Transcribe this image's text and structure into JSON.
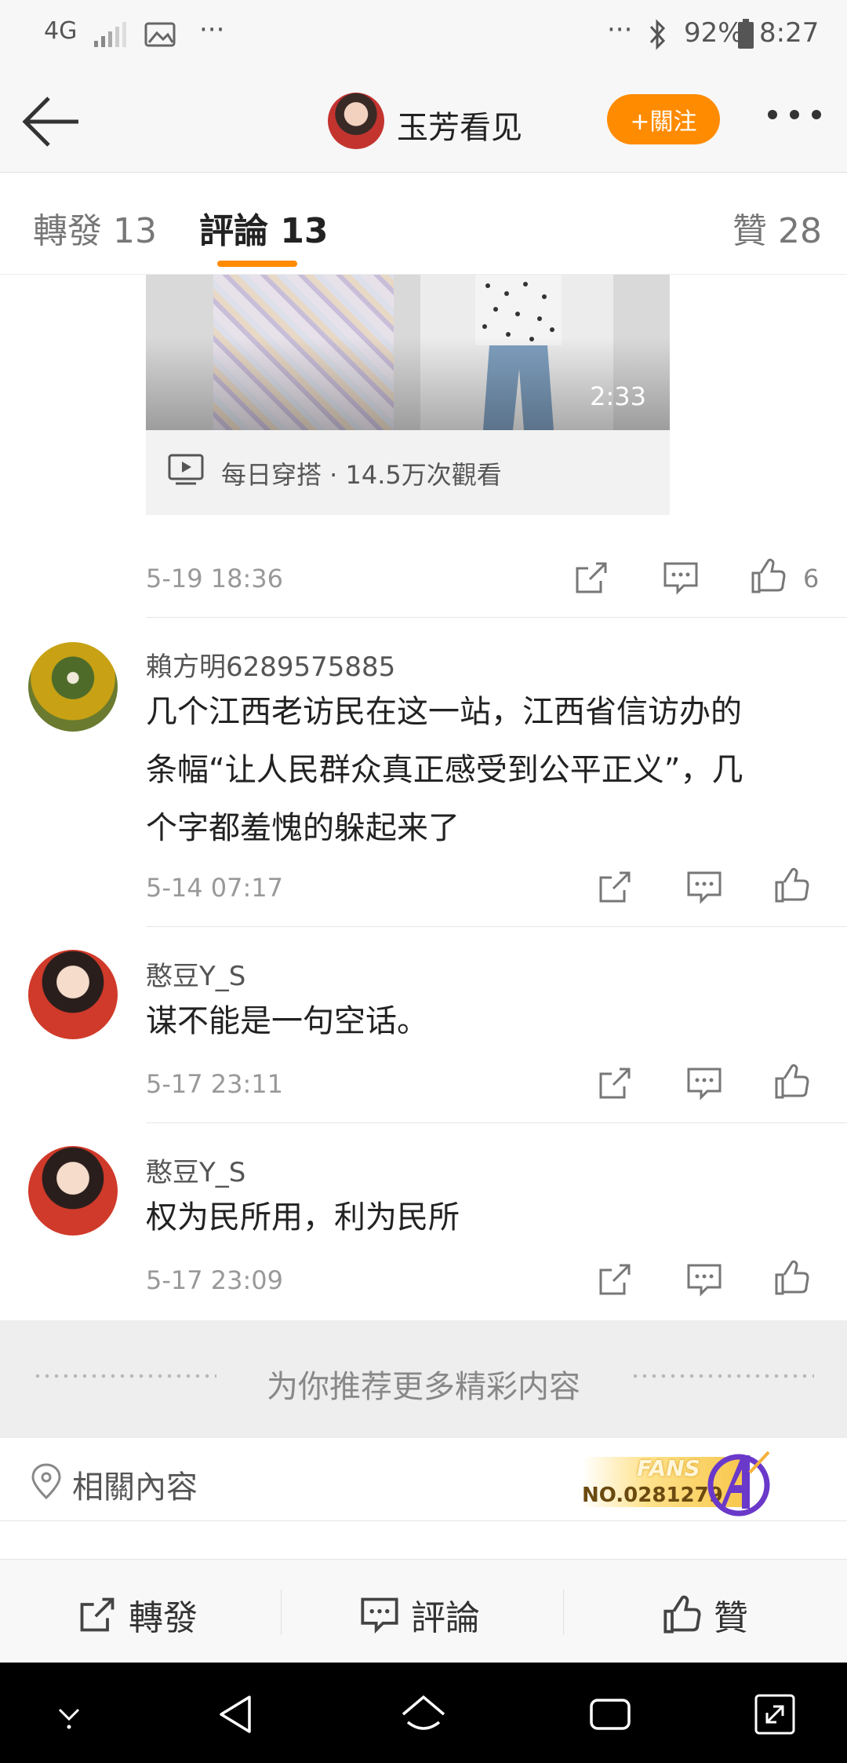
{
  "status_bar": {
    "network": "4G",
    "more": "···",
    "right_more": "···",
    "battery": "92%",
    "time": "8:27"
  },
  "header": {
    "username": "玉芳看见",
    "follow_label": "+關注"
  },
  "tabs": {
    "repost": "轉發 13",
    "comment": "評論 13",
    "like": "贊 28"
  },
  "video": {
    "duration": "2:33",
    "info": "每日穿搭 · 14.5万次觀看"
  },
  "post": {
    "time": "5-19 18:36",
    "likes": "6"
  },
  "comments": [
    {
      "user": "賴方明6289575885",
      "lines": [
        "几个江西老访民在这一站，江西省信访办的",
        "条幅“让人民群众真正感受到公平正义”，几",
        "个字都羞愧的躲起来了"
      ],
      "time": "5-14 07:17"
    },
    {
      "user": "憨豆Y_S",
      "lines": [
        "谋不能是一句空话。"
      ],
      "time": "5-17 23:11"
    },
    {
      "user": "憨豆Y_S",
      "lines": [
        "权为民所用，利为民所"
      ],
      "time": "5-17 23:09"
    }
  ],
  "recommend": {
    "label": "为你推荐更多精彩内容"
  },
  "related": {
    "label": "相關內容",
    "badge_title": "FANS",
    "badge_no": "NO.0281279"
  },
  "actions": {
    "repost": "轉發",
    "comment": "評論",
    "like": "贊"
  },
  "colors": {
    "accent": "#ff8b00",
    "background": "#ffffff",
    "navbar": "#000000"
  }
}
